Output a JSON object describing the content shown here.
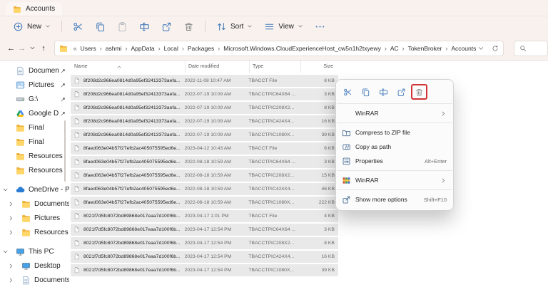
{
  "window": {
    "tab_title": "Accounts"
  },
  "toolbar": {
    "items": [
      {
        "kind": "label",
        "name": "new-button",
        "icon": "plus-circle",
        "label": "New",
        "chevron": true
      },
      {
        "kind": "sep"
      },
      {
        "kind": "icon",
        "name": "cut-button",
        "icon": "scissors"
      },
      {
        "kind": "icon",
        "name": "copy-button",
        "icon": "copy"
      },
      {
        "kind": "icon",
        "name": "paste-button",
        "icon": "paste",
        "disabled": true
      },
      {
        "kind": "icon",
        "name": "rename-button",
        "icon": "rename"
      },
      {
        "kind": "icon",
        "name": "share-button",
        "icon": "share"
      },
      {
        "kind": "icon",
        "name": "delete-button",
        "icon": "trash",
        "gray": true
      },
      {
        "kind": "sep"
      },
      {
        "kind": "label",
        "name": "sort-button",
        "icon": "sort-arrows",
        "label": "Sort",
        "chevron": true
      },
      {
        "kind": "label",
        "name": "view-button",
        "icon": "view-lines",
        "label": "View",
        "chevron": true
      },
      {
        "kind": "icon",
        "name": "more-button",
        "icon": "ellipsis"
      }
    ]
  },
  "addressbar": {
    "back_glyph": "←",
    "forward_glyph": "→",
    "up_glyph": "↑",
    "overflow_indicator": "«",
    "separator": "›",
    "crumbs": [
      "Users",
      "ashmi",
      "AppData",
      "Local",
      "Packages",
      "Microsoft.Windows.CloudExperienceHost_cw5n1h2txyewy",
      "AC",
      "TokenBroker",
      "Accounts"
    ]
  },
  "sidebar": {
    "items": [
      {
        "label": "Documen",
        "icon": "doc",
        "pinned": true
      },
      {
        "label": "Pictures",
        "icon": "pictures",
        "pinned": true
      },
      {
        "label": "G:\\",
        "icon": "drive",
        "pinned": true
      },
      {
        "label": "Google D",
        "icon": "gdrive",
        "pinned": true
      },
      {
        "label": "Final",
        "icon": "folder"
      },
      {
        "label": "Final",
        "icon": "folder"
      },
      {
        "label": "Resources",
        "icon": "folder"
      },
      {
        "label": "Resources",
        "icon": "folder"
      },
      {
        "label": "OneDrive - Pe",
        "icon": "cloud",
        "chevron": "down",
        "gap": true
      },
      {
        "label": "Documents",
        "icon": "folder",
        "chevron": "right",
        "indent": 1
      },
      {
        "label": "Pictures",
        "icon": "folder",
        "chevron": "right",
        "indent": 1
      },
      {
        "label": "Resources",
        "icon": "folder",
        "chevron": "right",
        "indent": 1
      },
      {
        "label": "This PC",
        "icon": "monitor",
        "chevron": "down",
        "gap": true
      },
      {
        "label": "Desktop",
        "icon": "monitor",
        "chevron": "right",
        "indent": 1
      },
      {
        "label": "Documents",
        "icon": "doc",
        "chevron": "right",
        "indent": 1
      }
    ]
  },
  "filelist": {
    "columns": [
      "Name",
      "Date modified",
      "Type",
      "Size"
    ],
    "sort_column": "Name",
    "sort_direction": "ascending",
    "rows": [
      {
        "name": "8f208d2c966ea0814d0a95ef32413373aefa...",
        "date": "2022-11-08 10:47 AM",
        "type": "TBACCT File",
        "size": "8 KB"
      },
      {
        "name": "8f208d2c966ea0814d0a95ef32413373aefa...",
        "date": "2022-07-19 10:09 AM",
        "type": "TBACCTPIC64X64 ...",
        "size": "3 KB"
      },
      {
        "name": "8f208d2c966ea0814d0a95ef32413373aefa...",
        "date": "2022-07-19 10:09 AM",
        "type": "TBACCTPIC208X2...",
        "size": "8 KB"
      },
      {
        "name": "8f208d2c966ea0814d0a95ef32413373aefa...",
        "date": "2022-07-19 10:09 AM",
        "type": "TBACCTPIC424X4...",
        "size": "16 KB"
      },
      {
        "name": "8f208d2c966ea0814d0a95ef32413373aefa...",
        "date": "2022-07-19 10:09 AM",
        "type": "TBACCTPIC1080X...",
        "size": "39 KB"
      },
      {
        "name": "8faed063e04b57f27efb2ac405075595ed6e...",
        "date": "2023-04-12 10:43 AM",
        "type": "TBACCT File",
        "size": "6 KB"
      },
      {
        "name": "8faed063e04b57f27efb2ac405075595ed6e...",
        "date": "2022-08-18 10:59 AM",
        "type": "TBACCTPIC64X64 ...",
        "size": "3 KB"
      },
      {
        "name": "8faed063e04b57f27efb2ac405075595ed6e...",
        "date": "2022-08-18 10:59 AM",
        "type": "TBACCTPIC208X2...",
        "size": "15 KB"
      },
      {
        "name": "8faed063e04b57f27efb2ac405075595ed6e...",
        "date": "2022-08-18 10:59 AM",
        "type": "TBACCTPIC424X4...",
        "size": "46 KB"
      },
      {
        "name": "8faed063e04b57f27efb2ac405075595ed6e...",
        "date": "2022-08-18 10:59 AM",
        "type": "TBACCTPIC1080X...",
        "size": "222 KB"
      },
      {
        "name": "8021f7d5fc8072bd89868e017eaa7d100f6b...",
        "date": "2023-04-17 1:01 PM",
        "type": "TBACCT File",
        "size": "4 KB"
      },
      {
        "name": "8021f7d5fc8072bd89868e017eaa7d100f6b...",
        "date": "2023-04-17 12:54 PM",
        "type": "TBACCTPIC64X64 ...",
        "size": "3 KB"
      },
      {
        "name": "8021f7d5fc8072bd89868e017eaa7d100f6b...",
        "date": "2023-04-17 12:54 PM",
        "type": "TBACCTPIC208X2...",
        "size": "8 KB"
      },
      {
        "name": "8021f7d5fc8072bd89868e017eaa7d100f6b...",
        "date": "2023-04-17 12:54 PM",
        "type": "TBACCTPIC424X4...",
        "size": "16 KB"
      },
      {
        "name": "8021f7d5fc8072bd89868e017eaa7d100f6b...",
        "date": "2023-04-17 12:54 PM",
        "type": "TBACCTPIC1080X...",
        "size": "39 KB"
      }
    ]
  },
  "context_menu": {
    "quick_actions": [
      {
        "name": "cut",
        "icon": "scissors"
      },
      {
        "name": "copy",
        "icon": "copy"
      },
      {
        "name": "rename",
        "icon": "rename"
      },
      {
        "name": "share",
        "icon": "share"
      },
      {
        "name": "delete",
        "icon": "trash",
        "gray": true,
        "highlighted": true
      }
    ],
    "items": [
      {
        "label": "WinRAR",
        "submenu": true
      },
      {
        "divider": true
      },
      {
        "label": "Compress to ZIP file",
        "icon": "zip"
      },
      {
        "label": "Copy as path",
        "icon": "copypath"
      },
      {
        "label": "Properties",
        "icon": "properties",
        "shortcut": "Alt+Enter"
      },
      {
        "divider": true
      },
      {
        "label": "WinRAR",
        "icon": "winrar",
        "submenu": true
      },
      {
        "divider": true
      },
      {
        "label": "Show more options",
        "icon": "showmore",
        "shortcut": "Shift+F10"
      }
    ]
  },
  "colors": {
    "chrome_bg": "#f8f1ee",
    "selection_row": "#e9e9e9",
    "toolbar_icon_blue": "#3d77b8",
    "toolbar_icon_gray": "#8b8b8b",
    "delete_highlight_red": "#d13438",
    "folder_yellow": "#fdc443",
    "menu_bg": "#fbfbfb"
  }
}
